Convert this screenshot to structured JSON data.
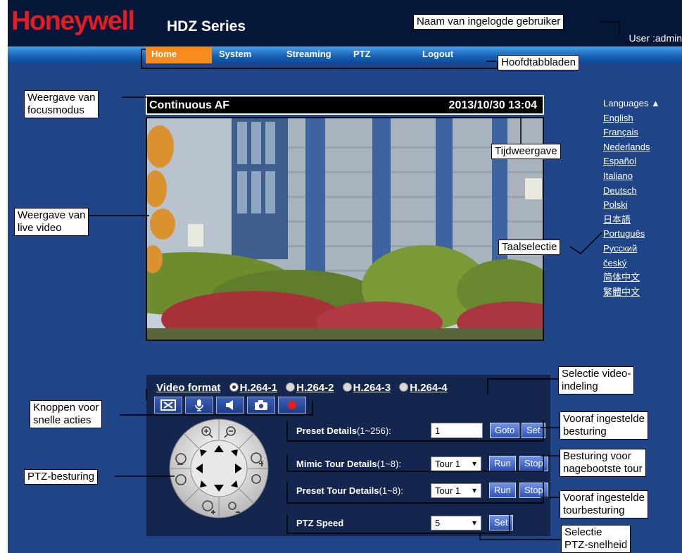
{
  "header": {
    "logo": "Honeywell",
    "product": "HDZ Series",
    "user_text": "User :admin"
  },
  "nav": {
    "tabs": [
      "Home",
      "System",
      "Streaming",
      "PTZ",
      "Logout"
    ],
    "active": "Home"
  },
  "video": {
    "focus_mode": "Continuous AF",
    "datetime": "2013/10/30 13:04"
  },
  "languages": {
    "header": "Languages ▲",
    "items": [
      "English",
      "Français",
      "Nederlands",
      "Español",
      "Italiano",
      "Deutsch",
      "Polski",
      "日本語",
      "Português",
      "Русский",
      "český",
      "简体中文",
      "繁體中文"
    ]
  },
  "controls": {
    "video_format_label": "Video format",
    "formats": [
      "H.264-1",
      "H.264-2",
      "H.264-3",
      "H.264-4"
    ],
    "selected_format": "H.264-1",
    "quick_actions": [
      "fullscreen-icon",
      "microphone-icon",
      "speaker-icon",
      "snapshot-camera-icon",
      "record-icon"
    ],
    "preset_details": {
      "label": "Preset Details",
      "range": "(1~256):",
      "value": "1",
      "goto": "Goto",
      "set": "Set"
    },
    "mimic_tour": {
      "label": "Mimic Tour Details",
      "range": "(1~8):",
      "value": "Tour 1",
      "run": "Run",
      "stop": "Stop"
    },
    "preset_tour": {
      "label": "Preset Tour Details",
      "range": "(1~8):",
      "value": "Tour 1",
      "run": "Run",
      "stop": "Stop"
    },
    "ptz_speed": {
      "label": "PTZ Speed",
      "value": "5",
      "set": "Set"
    }
  },
  "annotations": {
    "user_name": "Naam van ingelogde gebruiker",
    "main_tabs": "Hoofdtabbladen",
    "focus_mode": "Weergave van\nfocusmodus",
    "time_display": "Tijdweergave",
    "live_video": "Weergave van\nlive video",
    "language_select": "Taalselectie",
    "video_format": "Selectie video-\nindeling",
    "quick_actions": "Knoppen voor\nsnelle acties",
    "preset_control": "Vooraf ingestelde\nbesturing",
    "mimic_tour": "Besturing voor\nnagebootste tour",
    "ptz_control": "PTZ-besturing",
    "preset_tour": "Vooraf ingestelde\ntourbesturing",
    "ptz_speed": "Selectie\nPTZ-snelheid"
  },
  "colors": {
    "brand_red": "#e31b23",
    "page_bg": "#1f4487",
    "active_tab": "#f68b1f"
  }
}
